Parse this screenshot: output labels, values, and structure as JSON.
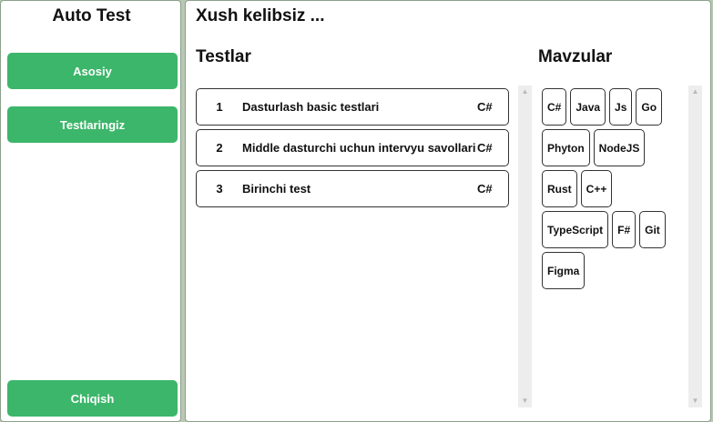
{
  "sidebar": {
    "title": "Auto Test",
    "nav": [
      {
        "label": "Asosiy"
      },
      {
        "label": "Testlaringiz"
      }
    ],
    "logout_label": "Chiqish"
  },
  "main": {
    "welcome": "Xush kelibsiz ...",
    "tests_title": "Testlar",
    "topics_title": "Mavzular",
    "tests": [
      {
        "num": "1",
        "name": "Dasturlash basic testlari",
        "lang": "C#"
      },
      {
        "num": "2",
        "name": "Middle dasturchi uchun intervyu savollari",
        "lang": "C#"
      },
      {
        "num": "3",
        "name": "Birinchi test",
        "lang": "C#"
      }
    ],
    "topics": [
      "C#",
      "Java",
      "Js",
      "Go",
      "Phyton",
      "NodeJS",
      "Rust",
      "C++",
      "TypeScript",
      "F#",
      "Git",
      "Figma"
    ]
  },
  "colors": {
    "accent": "#3cb66a",
    "background": "#b9c7b3"
  },
  "icons": {
    "scroll_up": "triangle-up-icon",
    "scroll_down": "triangle-down-icon"
  }
}
